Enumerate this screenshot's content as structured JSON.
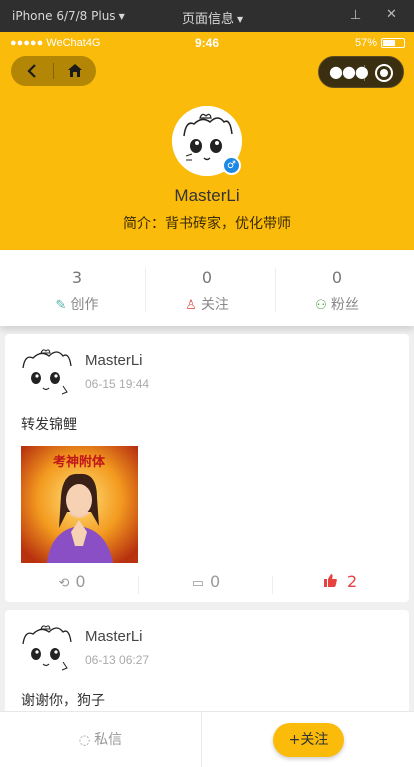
{
  "devtools": {
    "device": "iPhone 6/7/8 Plus",
    "page_info": "页面信息"
  },
  "status_bar": {
    "carrier": "●●●●● WeChat4G",
    "time": "9:46",
    "battery": "57%"
  },
  "profile": {
    "name": "MasterLi",
    "bio": "简介：背书砖家，优化带师",
    "gender_icon": "male-icon"
  },
  "stats": [
    {
      "count": "3",
      "label": "创作",
      "icon": "pencil-icon",
      "color": "#4fb3a6"
    },
    {
      "count": "0",
      "label": "关注",
      "icon": "user-icon",
      "color": "#e05a4f"
    },
    {
      "count": "0",
      "label": "粉丝",
      "icon": "users-icon",
      "color": "#55a84c"
    }
  ],
  "posts": [
    {
      "author": "MasterLi",
      "date": "06-15 19:44",
      "text": "转发锦鲤",
      "image_caption": "考神附体",
      "actions": {
        "forward": "0",
        "comment": "0",
        "like": "2"
      }
    },
    {
      "author": "MasterLi",
      "date": "06-13 06:27",
      "text": "谢谢你，狗子"
    }
  ],
  "bottom_bar": {
    "message_label": "私信",
    "follow_label": "+关注"
  },
  "colors": {
    "accent": "#fbbb0a",
    "like": "#e64340"
  }
}
